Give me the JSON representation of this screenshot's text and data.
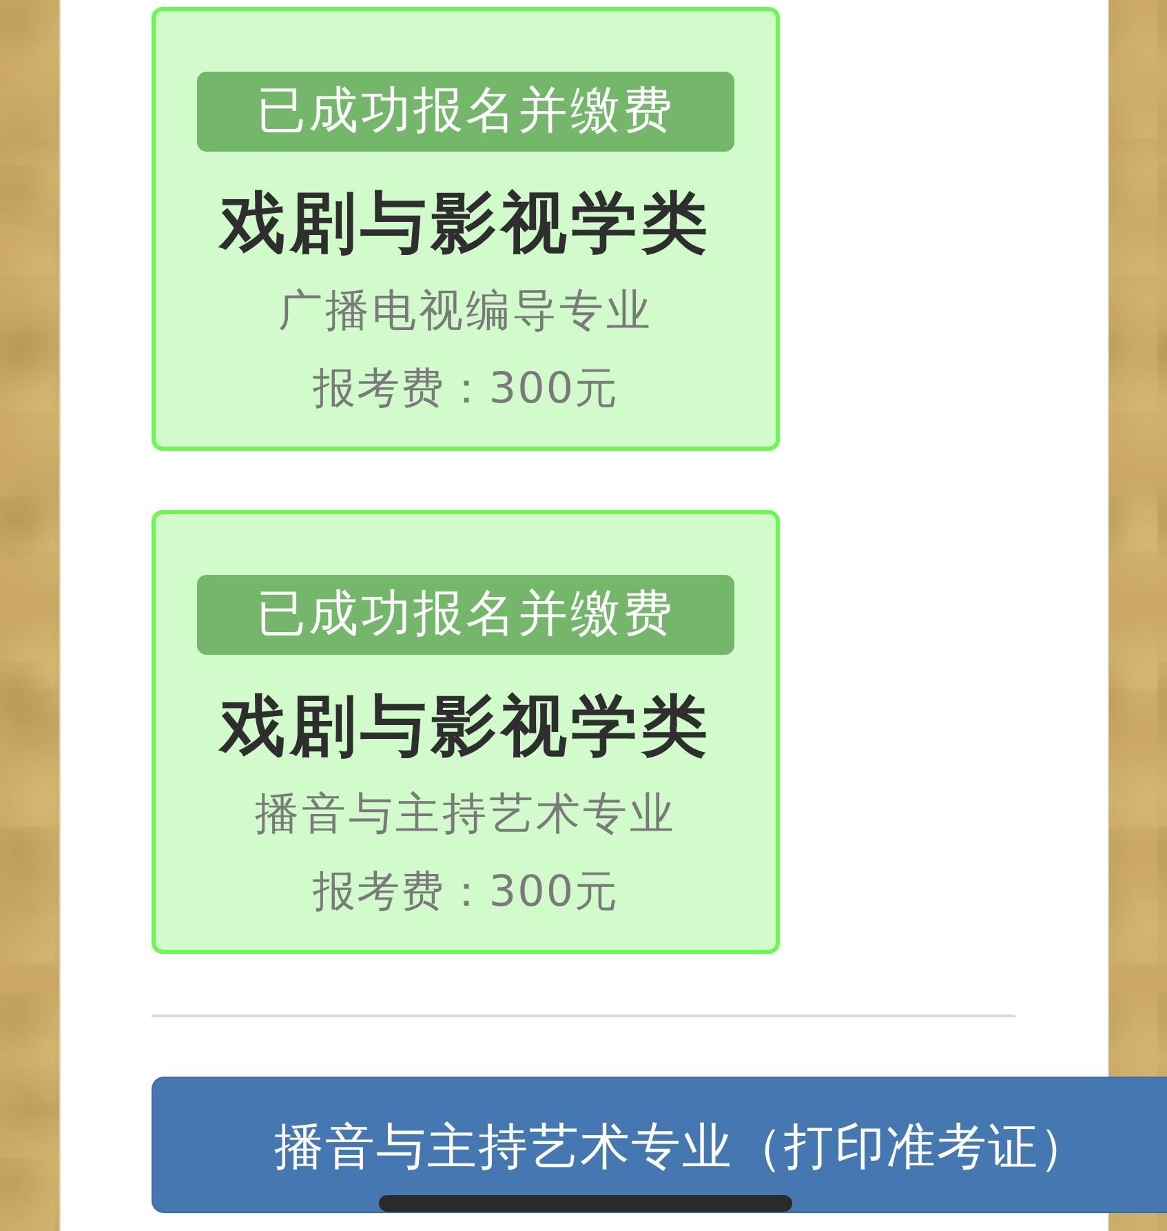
{
  "registrations": [
    {
      "status": "已成功报名并缴费",
      "category": "戏剧与影视学类",
      "major": "广播电视编导专业",
      "fee": "报考费：300元"
    },
    {
      "status": "已成功报名并缴费",
      "category": "戏剧与影视学类",
      "major": "播音与主持艺术专业",
      "fee": "报考费：300元"
    }
  ],
  "print_button": {
    "label": "播音与主持艺术专业（打印准考证）"
  }
}
